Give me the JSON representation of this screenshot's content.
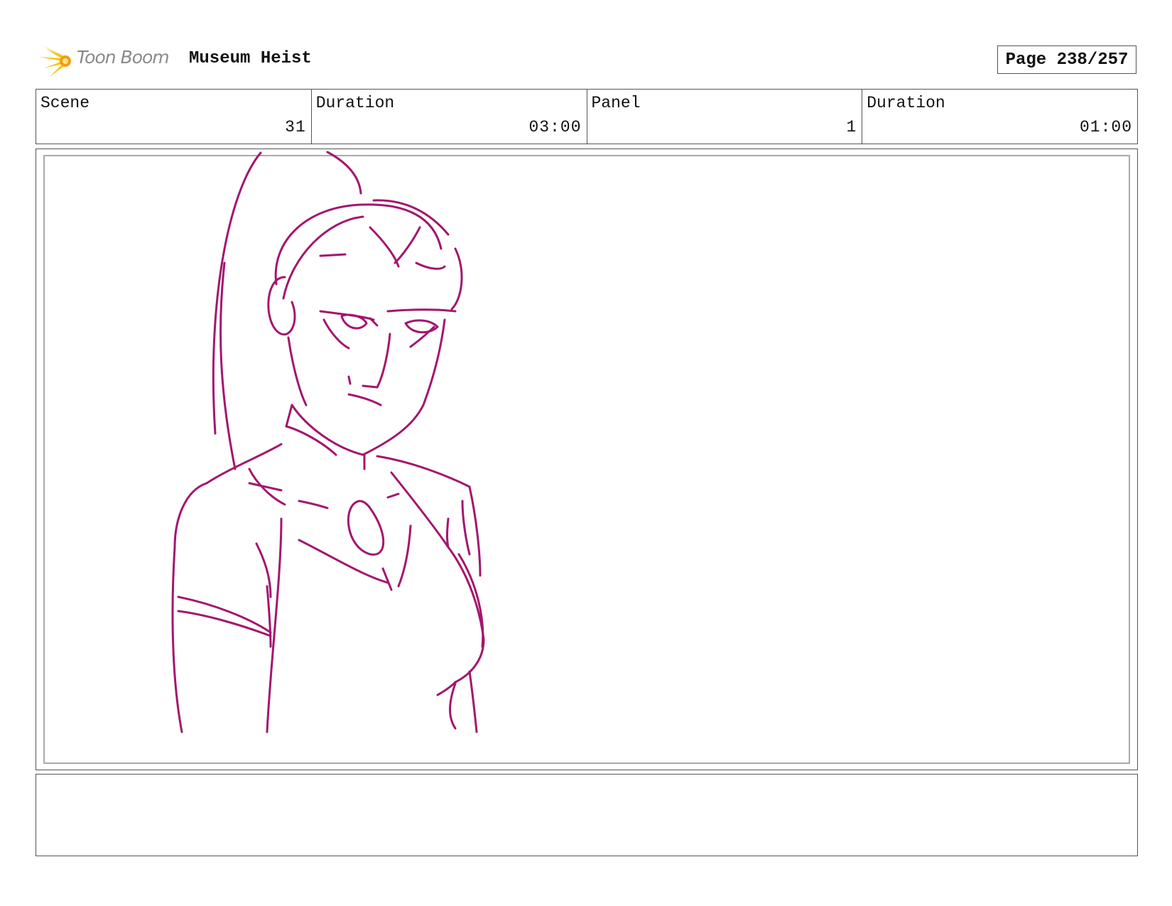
{
  "header": {
    "brand": "Toon Boom",
    "project_title": "Museum Heist",
    "page_label": "Page 238/257"
  },
  "info": [
    {
      "label": "Scene",
      "value": "31"
    },
    {
      "label": "Duration",
      "value": "03:00"
    },
    {
      "label": "Panel",
      "value": "1"
    },
    {
      "label": "Duration",
      "value": "01:00"
    }
  ],
  "sketch": {
    "stroke_color": "#a3166e",
    "subject": "character-sketch"
  },
  "notes": {
    "text": ""
  },
  "colors": {
    "logo_yellow": "#f5c518",
    "logo_orange": "#f39c12",
    "border": "#555555"
  }
}
